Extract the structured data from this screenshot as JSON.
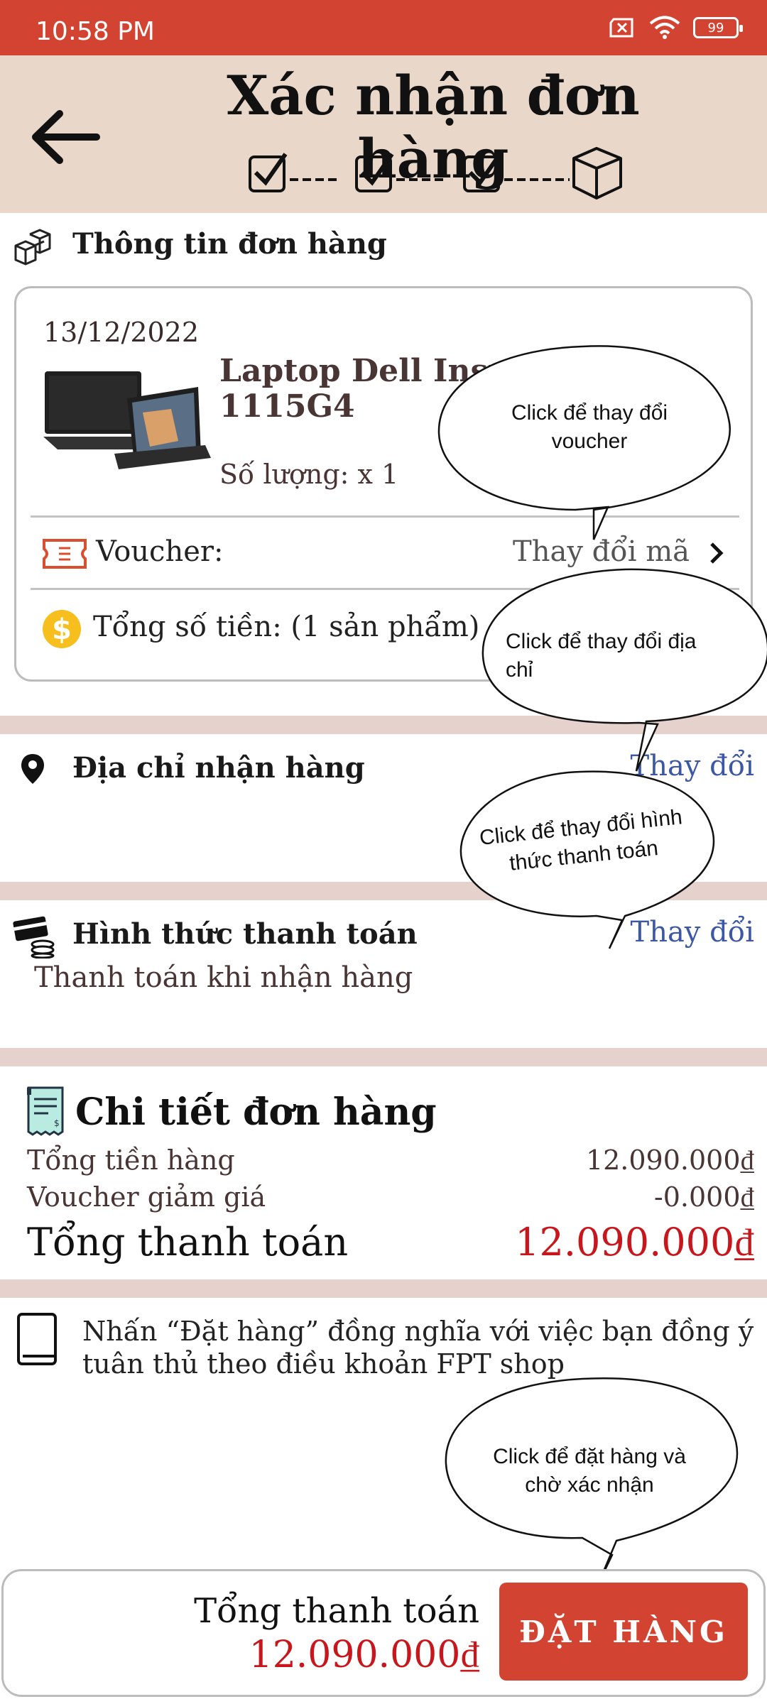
{
  "status_bar": {
    "time": "10:58 PM",
    "battery": "99"
  },
  "header": {
    "title": "Xác nhận đơn hàng"
  },
  "order_info": {
    "section_title": "Thông tin đơn hàng",
    "date": "13/12/2022",
    "product_name_line1": "Laptop Dell Inspi",
    "product_name_line2": "1115G4",
    "quantity": "Số lượng: x 1",
    "voucher_label": "Voucher:",
    "voucher_action": "Thay đổi mã",
    "total_label": "Tổng số tiền: (1 sản phẩm)"
  },
  "address": {
    "section_title": "Địa chỉ nhận hàng",
    "change_label": "Thay đổi"
  },
  "payment": {
    "section_title": "Hình thức thanh toán",
    "method": "Thanh toán khi nhận hàng",
    "change_label": "Thay đổi"
  },
  "details": {
    "section_title": "Chi tiết đơn hàng",
    "rows": [
      {
        "label": "Tổng tiền hàng",
        "value": "12.090.000₫"
      },
      {
        "label": "Voucher giảm giá",
        "value": "-0.000₫"
      }
    ],
    "grand_label": "Tổng thanh toán",
    "grand_value": "12.090.000₫"
  },
  "terms": {
    "line1": "Nhấn “Đặt hàng” đồng nghĩa với việc bạn đồng ý",
    "line2": "tuân thủ  theo điều khoản FPT shop"
  },
  "bubbles": {
    "voucher_l1": "Click để thay đổi",
    "voucher_l2": "voucher",
    "address_l1": "Click để thay đổi địa",
    "address_l2": "chỉ",
    "payment_l1": "Click để thay đổi hình",
    "payment_l2": "thức thanh toán",
    "order_l1": "Click để đặt hàng và",
    "order_l2": "chờ xác nhận"
  },
  "bottom": {
    "total_label": "Tổng thanh toán",
    "total_value": "12.090.000₫",
    "button_label": "ĐẶT HÀNG"
  },
  "colors": {
    "accent": "#d34331",
    "header_bg": "#e9d8ca",
    "price_red": "#c8171c",
    "link_blue": "#3c57a3"
  }
}
